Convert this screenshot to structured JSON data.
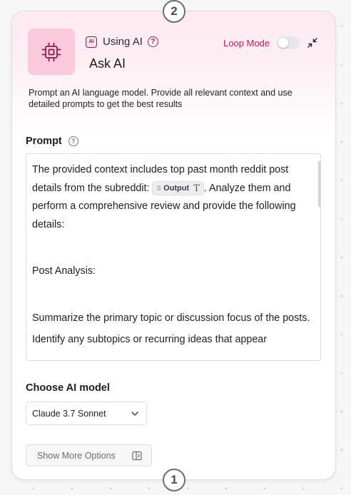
{
  "steps": {
    "top": "2",
    "bottom": "1"
  },
  "node": {
    "chip_text": "AI",
    "using_label": "Using AI",
    "help_glyph": "?",
    "title": "Ask AI",
    "loop_mode_label": "Loop Mode",
    "loop_mode_on": false,
    "description": "Prompt an AI language model. Provide all relevant context and use detailed prompts to get the best results",
    "icon": "cpu-chip-icon",
    "accent_color": "#c2185b",
    "tile_color": "#f9c9dd"
  },
  "prompt": {
    "label": "Prompt",
    "before_chip": "The provided context includes top past month reddit post details from the subreddit: ",
    "chip_label": "Output",
    "chip_type_glyph": "T",
    "after_chip": ". Analyze them and perform a comprehensive review and provide the following details:",
    "heading": "Post Analysis:",
    "line_1": "Summarize the primary topic or discussion focus of the posts.",
    "line_2": "Identify any subtopics or recurring ideas that appear"
  },
  "model": {
    "label": "Choose AI model",
    "selected": "Claude 3.7 Sonnet"
  },
  "more_options_label": "Show More Options"
}
